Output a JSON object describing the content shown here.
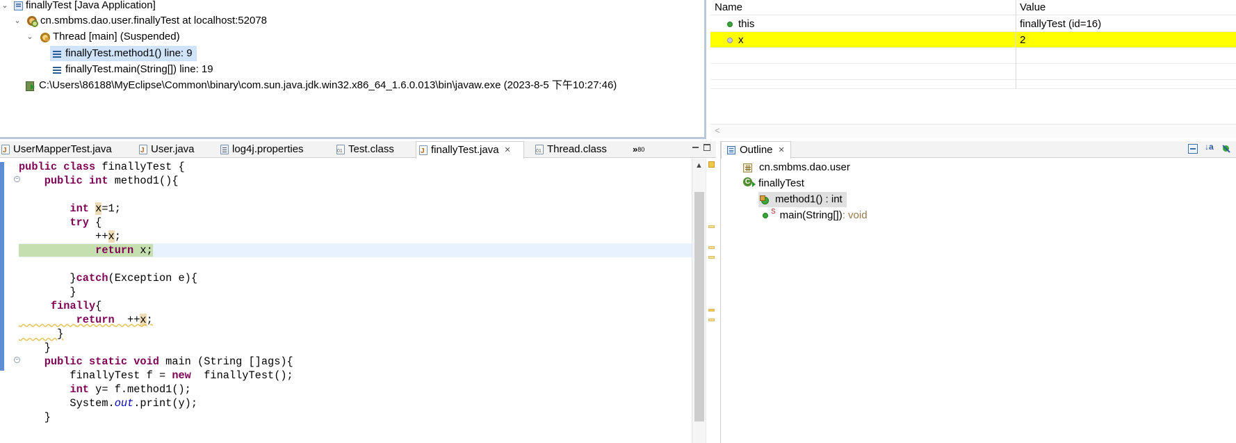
{
  "debug": {
    "launch": "finallyTest [Java Application]",
    "target": "cn.smbms.dao.user.finallyTest at localhost:52078",
    "thread": "Thread [main] (Suspended)",
    "frames": [
      "finallyTest.method1() line: 9",
      "finallyTest.main(String[]) line: 19"
    ],
    "process": "C:\\Users\\86188\\MyEclipse\\Common\\binary\\com.sun.java.jdk.win32.x86_64_1.6.0.013\\bin\\javaw.exe (2023-8-5 下午10:27:46)"
  },
  "variables": {
    "col_name": "Name",
    "col_value": "Value",
    "rows": [
      {
        "name": "this",
        "value": "finallyTest  (id=16)"
      },
      {
        "name": "x",
        "value": "2"
      }
    ],
    "scroll_hint": "<"
  },
  "editor": {
    "tabs": [
      {
        "label": "UserMapperTest.java"
      },
      {
        "label": "User.java"
      },
      {
        "label": "log4j.properties"
      },
      {
        "label": "Test.class"
      },
      {
        "label": "finallyTest.java",
        "close": "✕"
      },
      {
        "label": "Thread.class"
      }
    ],
    "overflow": "»",
    "overflow_count": "80"
  },
  "outline": {
    "title": "Outline",
    "close": "✕",
    "package": "cn.smbms.dao.user",
    "class": "finallyTest",
    "members": [
      {
        "name": "method1() : int"
      },
      {
        "modifier": "S",
        "name": "main(String[])",
        "type": " : void"
      }
    ]
  },
  "colors": {
    "keyword": "#7f0055",
    "static_field": "#0000c0",
    "variable_highlight": "#ffff00",
    "execution_line": "#c6dfb0",
    "current_line": "#e8f2fe"
  }
}
